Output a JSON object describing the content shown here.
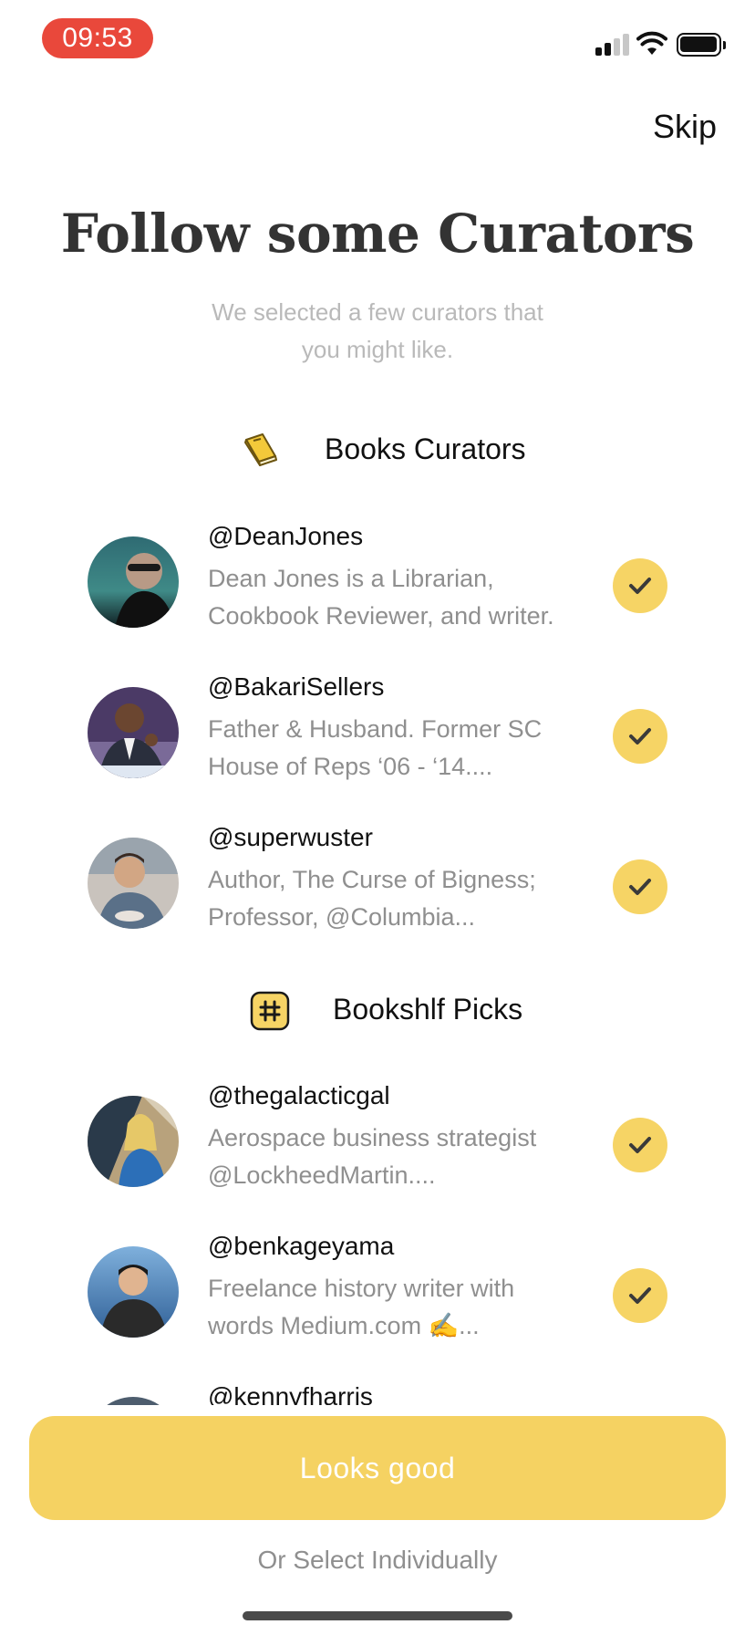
{
  "status_bar": {
    "time": "09:53"
  },
  "header": {
    "skip_label": "Skip"
  },
  "intro": {
    "title": "Follow some Curators",
    "subtitle_line1": "We selected a few curators that",
    "subtitle_line2": "you might like."
  },
  "sections": [
    {
      "label": "Books Curators",
      "icon": "book-icon",
      "curators": [
        {
          "handle": "@DeanJones",
          "bio_line1": "Dean  Jones is a Librarian,",
          "bio_line2": "Cookbook Reviewer, and writer.",
          "followed": true
        },
        {
          "handle": "@BakariSellers",
          "bio_line1": "Father & Husband. Former SC",
          "bio_line2": "House of Reps ‘06 - ‘14....",
          "followed": true
        },
        {
          "handle": "@superwuster",
          "bio_line1": "Author, The Curse of Bigness;",
          "bio_line2": "Professor, @Columbia...",
          "followed": true
        }
      ]
    },
    {
      "label": "Bookshlf Picks",
      "icon": "bookshlf-logo-icon",
      "curators": [
        {
          "handle": "@thegalacticgal",
          "bio_line1": "Aerospace business strategist",
          "bio_line2": "@LockheedMartin....",
          "followed": true
        },
        {
          "handle": "@benkageyama",
          "bio_line1": "Freelance history writer with",
          "bio_line2": "words Medium.com ✍️...",
          "followed": true
        },
        {
          "handle": "@kennyfharris",
          "bio_line1": "",
          "bio_line2": "",
          "followed": true
        }
      ]
    }
  ],
  "footer": {
    "primary_button": "Looks good",
    "secondary_link": "Or Select Individually"
  },
  "colors": {
    "accent_yellow": "#f5d262",
    "time_pill_red": "#e9483b",
    "muted_text": "#8f8f8f"
  }
}
